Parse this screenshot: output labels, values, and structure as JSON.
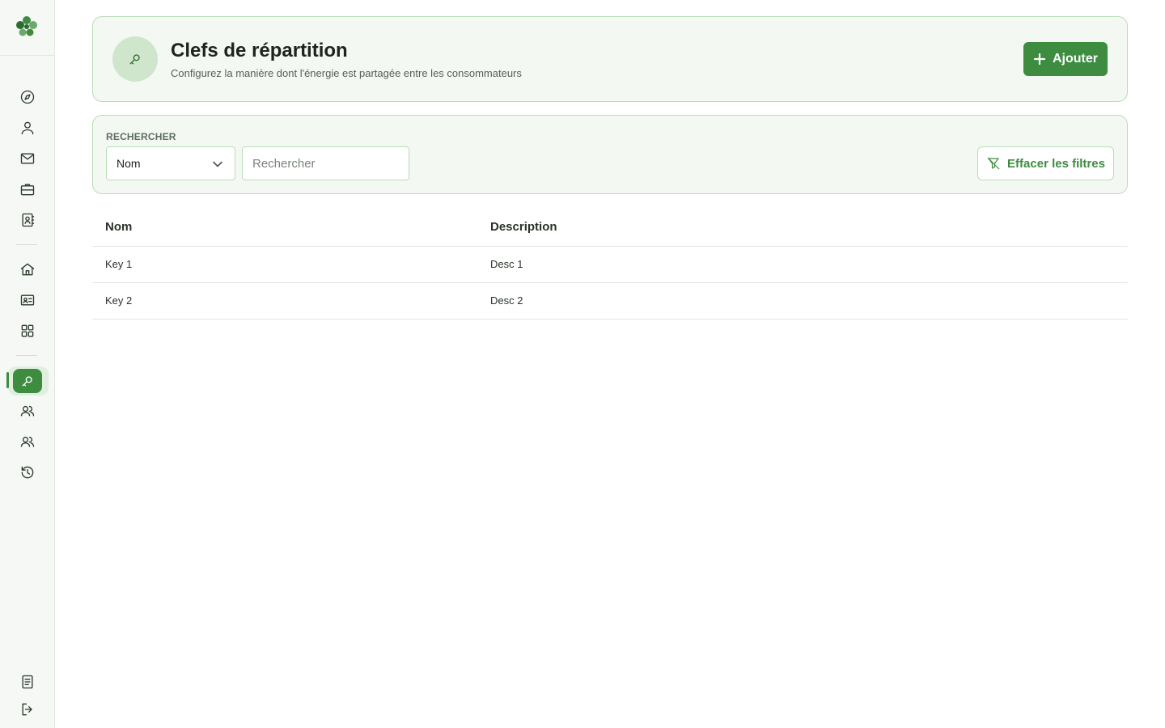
{
  "sidebar": {
    "logo": "clover-logo",
    "items": [
      {
        "icon": "compass-icon",
        "active": false
      },
      {
        "icon": "user-icon",
        "active": false
      },
      {
        "icon": "mail-icon",
        "active": false
      },
      {
        "icon": "briefcase-icon",
        "active": false
      },
      {
        "icon": "contact-book-icon",
        "active": false
      },
      {
        "icon": "home-icon",
        "active": false
      },
      {
        "icon": "id-card-icon",
        "active": false
      },
      {
        "icon": "grid-icon",
        "active": false
      },
      {
        "icon": "key-icon",
        "active": true
      },
      {
        "icon": "users-icon",
        "active": false
      },
      {
        "icon": "users-icon",
        "active": false
      },
      {
        "icon": "history-icon",
        "active": false
      }
    ],
    "bottom_items": [
      {
        "icon": "document-icon"
      },
      {
        "icon": "logout-icon"
      }
    ]
  },
  "header": {
    "title": "Clefs de répartition",
    "subtitle": "Configurez la manière dont l'énergie est partagée entre les consommateurs",
    "add_label": "Ajouter"
  },
  "filters": {
    "label": "RECHERCHER",
    "field_selected": "Nom",
    "search_placeholder": "Rechercher",
    "search_value": "",
    "clear_label": "Effacer les filtres"
  },
  "table": {
    "columns": [
      "Nom",
      "Description"
    ],
    "rows": [
      {
        "name": "Key 1",
        "description": "Desc 1"
      },
      {
        "name": "Key 2",
        "description": "Desc 2"
      }
    ]
  },
  "colors": {
    "accent": "#3d8c40",
    "card_bg": "#f3f9f2",
    "card_border": "#b9dcb9"
  }
}
